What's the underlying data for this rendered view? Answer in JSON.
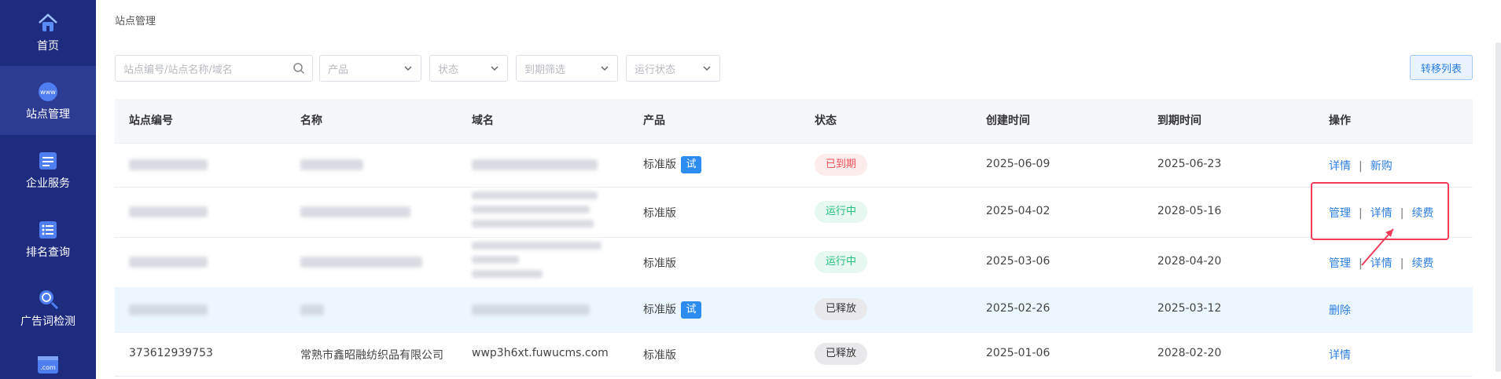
{
  "sidebar": {
    "items": [
      {
        "label": "首页",
        "icon": "home-icon"
      },
      {
        "label": "站点管理",
        "icon": "www-icon",
        "icon_text": "www",
        "active": true
      },
      {
        "label": "企业服务",
        "icon": "service-icon"
      },
      {
        "label": "排名查询",
        "icon": "ranking-list-icon"
      },
      {
        "label": "广告词检测",
        "icon": "search-check-icon"
      },
      {
        "label": "",
        "icon": "domain-icon",
        "icon_text": ".com"
      }
    ]
  },
  "breadcrumb": "站点管理",
  "filters": {
    "search_placeholder": "站点编号/站点名称/域名",
    "product_placeholder": "产品",
    "status_placeholder": "状态",
    "expiry_placeholder": "到期筛选",
    "run_status_placeholder": "运行状态"
  },
  "toolbar": {
    "transfer_label": "转移列表"
  },
  "table": {
    "headers": [
      "站点编号",
      "名称",
      "域名",
      "产品",
      "状态",
      "创建时间",
      "到期时间",
      "操作"
    ],
    "rows": [
      {
        "id": "",
        "name": "",
        "domain": "",
        "product": "标准版",
        "trial": "试",
        "status": "已到期",
        "status_type": "expired",
        "created": "2025-06-09",
        "expires": "2025-06-23",
        "actions": [
          "详情",
          "新购"
        ]
      },
      {
        "id": "",
        "name": "",
        "domain": "",
        "product": "标准版",
        "trial": "",
        "status": "运行中",
        "status_type": "running",
        "created": "2025-04-02",
        "expires": "2028-05-16",
        "actions": [
          "管理",
          "详情",
          "续费"
        ]
      },
      {
        "id": "",
        "name": "",
        "domain": "",
        "product": "标准版",
        "trial": "",
        "status": "运行中",
        "status_type": "running",
        "created": "2025-03-06",
        "expires": "2028-04-20",
        "actions": [
          "管理",
          "详情",
          "续费"
        ]
      },
      {
        "id": "",
        "name": "",
        "domain": "",
        "product": "标准版",
        "trial": "试",
        "status": "已释放",
        "status_type": "released",
        "created": "2025-02-26",
        "expires": "2025-03-12",
        "actions": [
          "删除"
        ]
      },
      {
        "id": "373612939753",
        "name": "常熟市鑫昭融纺织品有限公司",
        "domain": "wwp3h6xt.fuwucms.com",
        "product": "标准版",
        "trial": "",
        "status": "已释放",
        "status_type": "released",
        "created": "2025-01-06",
        "expires": "2028-02-20",
        "actions": [
          "详情"
        ]
      }
    ]
  },
  "annotation": {
    "highlight_color": "#f23c5a"
  }
}
